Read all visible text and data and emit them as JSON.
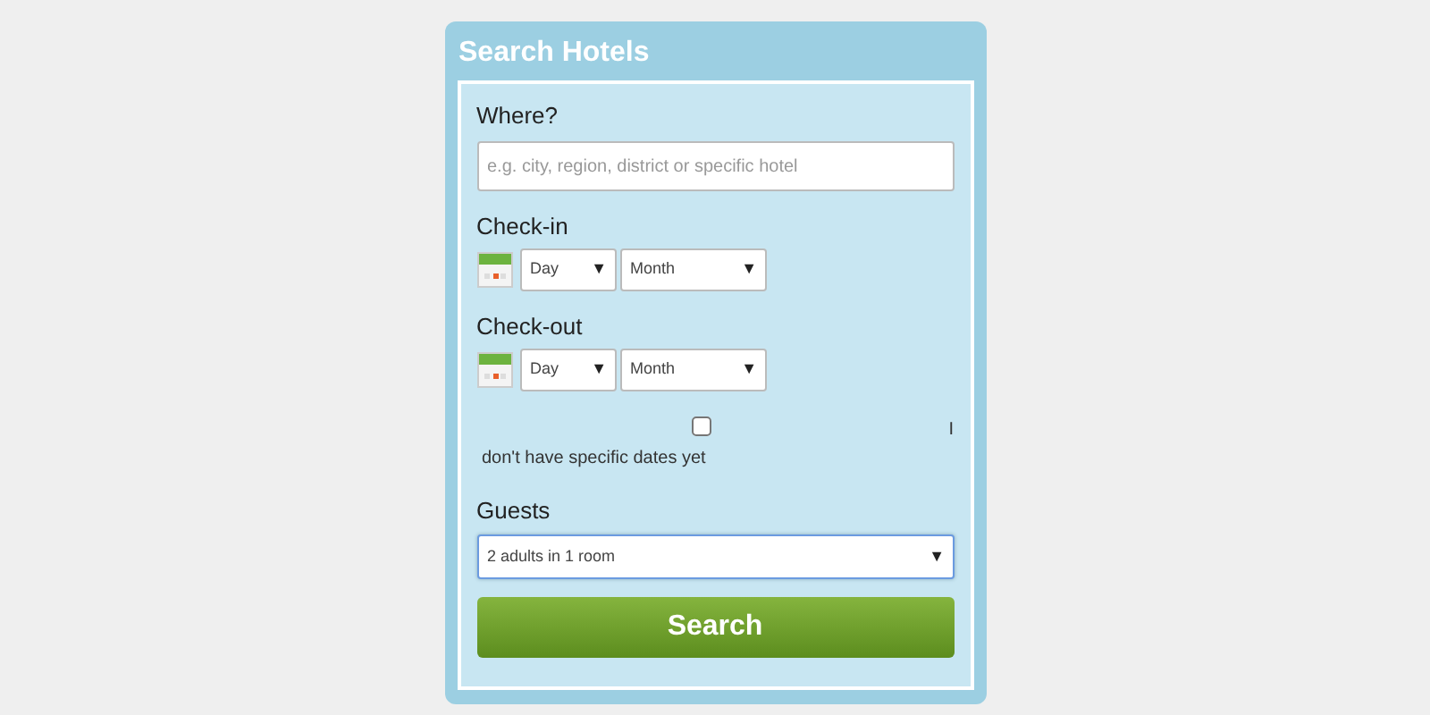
{
  "panel": {
    "title": "Search Hotels"
  },
  "where": {
    "label": "Where?",
    "placeholder": "e.g. city, region, district or specific hotel"
  },
  "date_groups": [
    {
      "label": "Check-in",
      "day": {
        "value": "Day",
        "arrow": "▼"
      },
      "month": {
        "value": "Month",
        "arrow": "▼"
      }
    },
    {
      "label": "Check-out",
      "day": {
        "value": "Day",
        "arrow": "▼"
      },
      "month": {
        "value": "Month",
        "arrow": "▼"
      }
    }
  ],
  "no_dates": {
    "checked": false,
    "label": "don't have specific dates yet",
    "mark": "I"
  },
  "guests": {
    "label": "Guests",
    "value": "2 adults in 1 room",
    "arrow": "▼",
    "focused": true
  },
  "search_button": "Search"
}
